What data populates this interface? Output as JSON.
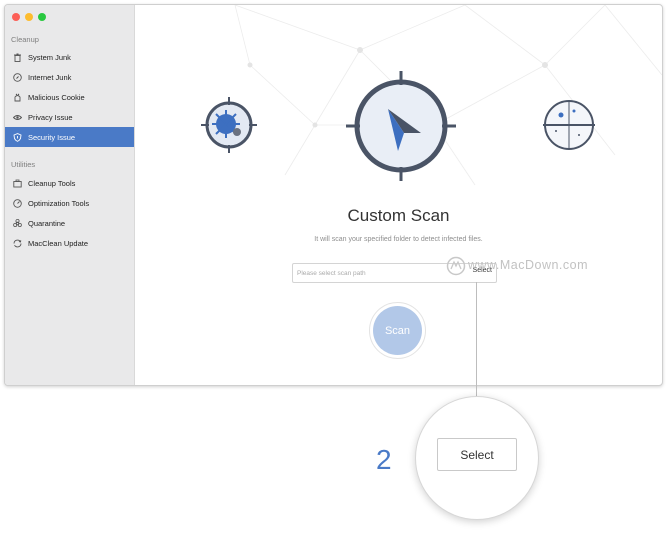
{
  "sidebar": {
    "sections": [
      {
        "title": "Cleanup",
        "items": [
          {
            "label": "System Junk",
            "icon": "trash-icon"
          },
          {
            "label": "Internet Junk",
            "icon": "compass-icon"
          },
          {
            "label": "Malicious Cookie",
            "icon": "cookie-icon"
          },
          {
            "label": "Privacy Issue",
            "icon": "eye-icon"
          },
          {
            "label": "Security Issue",
            "icon": "shield-icon",
            "active": true
          }
        ]
      },
      {
        "title": "Utilities",
        "items": [
          {
            "label": "Cleanup Tools",
            "icon": "briefcase-icon"
          },
          {
            "label": "Optimization Tools",
            "icon": "gauge-icon"
          },
          {
            "label": "Quarantine",
            "icon": "biohazard-icon"
          },
          {
            "label": "MacClean Update",
            "icon": "update-icon"
          }
        ]
      }
    ]
  },
  "main": {
    "title": "Custom Scan",
    "subtitle": "It will scan your specified folder to detect infected files.",
    "path_placeholder": "Please select scan path",
    "select_label": "Select",
    "scan_label": "Scan"
  },
  "watermark": "www.MacDown.com",
  "callout": {
    "step": "2",
    "select_label": "Select"
  },
  "colors": {
    "accent": "#4a7ac7",
    "scan_button": "#b2c8e8",
    "sidebar_bg": "#e9e9ea"
  }
}
